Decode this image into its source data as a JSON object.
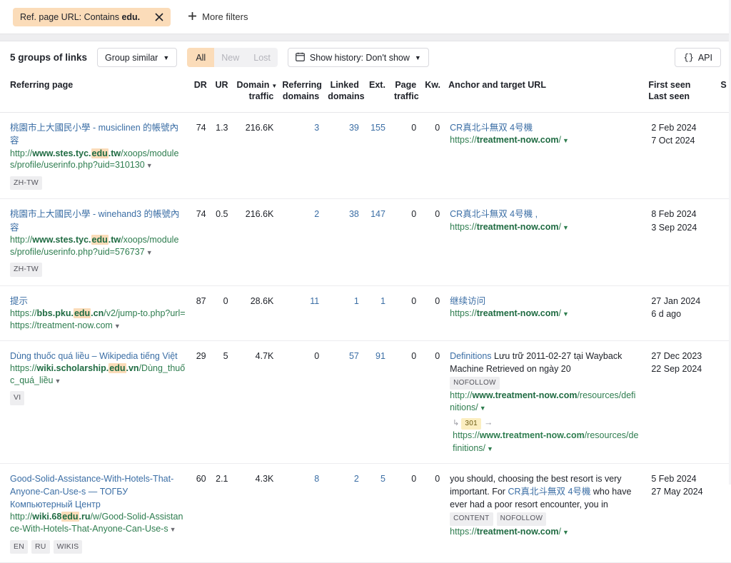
{
  "filter_bar": {
    "chip_prefix": "Ref. page URL: Contains ",
    "chip_value": "edu.",
    "close_icon": "close-icon",
    "more_filters_label": "More filters",
    "plus_icon": "plus-icon"
  },
  "toolbar": {
    "groups_label": "5 groups of links",
    "group_similar_label": "Group similar",
    "segments": [
      {
        "label": "All",
        "active": true
      },
      {
        "label": "New",
        "active": false
      },
      {
        "label": "Lost",
        "active": false
      }
    ],
    "history_label": "Show history: Don't show",
    "calendar_icon": "calendar-icon",
    "api_label": "API",
    "api_icon": "braces-icon",
    "caret_icon": "chevron-down-icon"
  },
  "table": {
    "headers": {
      "referring_page": "Referring page",
      "dr": "DR",
      "ur": "UR",
      "domain_traffic": "Domain traffic",
      "domain_traffic_l1": "Domain",
      "domain_traffic_l2": "traffic",
      "referring_domains_l1": "Referring",
      "referring_domains_l2": "domains",
      "linked_domains_l1": "Linked",
      "linked_domains_l2": "domains",
      "ext": "Ext.",
      "page_traffic_l1": "Page",
      "page_traffic_l2": "traffic",
      "kw": "Kw.",
      "anchor": "Anchor and target URL",
      "first_seen": "First seen",
      "last_seen": "Last seen",
      "trailing": "S"
    },
    "rows": [
      {
        "title": "桃園市上大國民小學 - musiclinen 的帳號內容",
        "url_prefix": "http://",
        "url_bold_pre": "www.stes.tyc.",
        "url_highlight": "edu",
        "url_bold_post": ".tw",
        "url_rest": "/xoops/modules/profile/userinfo.php?uid=310130",
        "tags": [
          "ZH-TW"
        ],
        "dr": "74",
        "ur": "1.3",
        "domain_traffic": "216.6K",
        "referring_domains": "3",
        "linked_domains": "39",
        "ext": "155",
        "page_traffic": "0",
        "kw": "0",
        "anchor_title": "CR真北斗無双 4号機",
        "anchor_text": "",
        "anchor_badges": [],
        "target_prefix": "https://",
        "target_bold": "treatment-now.com",
        "target_rest": "/",
        "redirect": null,
        "first_seen": "2 Feb 2024",
        "last_seen": "7 Oct 2024"
      },
      {
        "title": "桃園市上大國民小學 - winehand3 的帳號內容",
        "url_prefix": "http://",
        "url_bold_pre": "www.stes.tyc.",
        "url_highlight": "edu",
        "url_bold_post": ".tw",
        "url_rest": "/xoops/modules/profile/userinfo.php?uid=576737",
        "tags": [
          "ZH-TW"
        ],
        "dr": "74",
        "ur": "0.5",
        "domain_traffic": "216.6K",
        "referring_domains": "2",
        "linked_domains": "38",
        "ext": "147",
        "page_traffic": "0",
        "kw": "0",
        "anchor_title": "CR真北斗無双 4号機 ,",
        "anchor_text": "",
        "anchor_badges": [],
        "target_prefix": "https://",
        "target_bold": "treatment-now.com",
        "target_rest": "/",
        "redirect": null,
        "first_seen": "8 Feb 2024",
        "last_seen": "3 Sep 2024"
      },
      {
        "title": "提示",
        "url_prefix": "https://",
        "url_bold_pre": "bbs.pku.",
        "url_highlight": "edu",
        "url_bold_post": ".cn",
        "url_rest": "/v2/jump-to.php?url=https://treatment-now.com",
        "tags": [],
        "dr": "87",
        "ur": "0",
        "domain_traffic": "28.6K",
        "referring_domains": "11",
        "linked_domains": "1",
        "ext": "1",
        "page_traffic": "0",
        "kw": "0",
        "anchor_title": "继续访问",
        "anchor_text": "",
        "anchor_badges": [],
        "target_prefix": "https://",
        "target_bold": "treatment-now.com",
        "target_rest": "/",
        "redirect": null,
        "first_seen": "27 Jan 2024",
        "last_seen": "6 d ago"
      },
      {
        "title": "Dùng thuốc quá liều – Wikipedia tiếng Việt",
        "url_prefix": "https://",
        "url_bold_pre": "wiki.scholarship.",
        "url_highlight": "edu",
        "url_bold_post": ".vn",
        "url_rest": "/Dùng_thuốc_quá_liều",
        "tags": [
          "VI"
        ],
        "dr": "29",
        "ur": "5",
        "domain_traffic": "4.7K",
        "referring_domains": "0",
        "referring_domains_plain": true,
        "linked_domains": "57",
        "ext": "91",
        "page_traffic": "0",
        "kw": "0",
        "anchor_title": "Definitions",
        "anchor_text": " Lưu trữ 2011-02-27 tại Wayback Machine Retrieved on ngày 20",
        "anchor_badges": [
          "NOFOLLOW"
        ],
        "target_prefix": "http://",
        "target_bold": "www.treatment-now.com",
        "target_rest": "/resources/definitions/",
        "redirect": {
          "code": "301",
          "prefix": "https://",
          "bold": "www.treatment-now.com",
          "rest": "/resources/definitions/"
        },
        "first_seen": "27 Dec 2023",
        "last_seen": "22 Sep 2024"
      },
      {
        "title": "Good-Solid-Assistance-With-Hotels-That-Anyone-Can-Use-s — ТОГБУ Компьютерный Центр",
        "url_prefix": "http://",
        "url_bold_pre": "wiki.68",
        "url_highlight": "edu",
        "url_bold_post": ".ru",
        "url_rest": "/w/Good-Solid-Assistance-With-Hotels-That-Anyone-Can-Use-s",
        "tags": [
          "EN",
          "RU",
          "WIKIS"
        ],
        "dr": "60",
        "ur": "2.1",
        "domain_traffic": "4.3K",
        "referring_domains": "8",
        "linked_domains": "2",
        "ext": "5",
        "page_traffic": "0",
        "kw": "0",
        "anchor_title": "",
        "anchor_pre": "you should, choosing the best resort is very important. For ",
        "anchor_mid_link": "CR真北斗無双 4号機",
        "anchor_post": " who have ever had a poor resort encounter, you in",
        "anchor_badges": [
          "CONTENT",
          "NOFOLLOW"
        ],
        "target_prefix": "https://",
        "target_bold": "treatment-now.com",
        "target_rest": "/",
        "redirect": null,
        "first_seen": "5 Feb 2024",
        "last_seen": "27 May 2024"
      }
    ]
  }
}
